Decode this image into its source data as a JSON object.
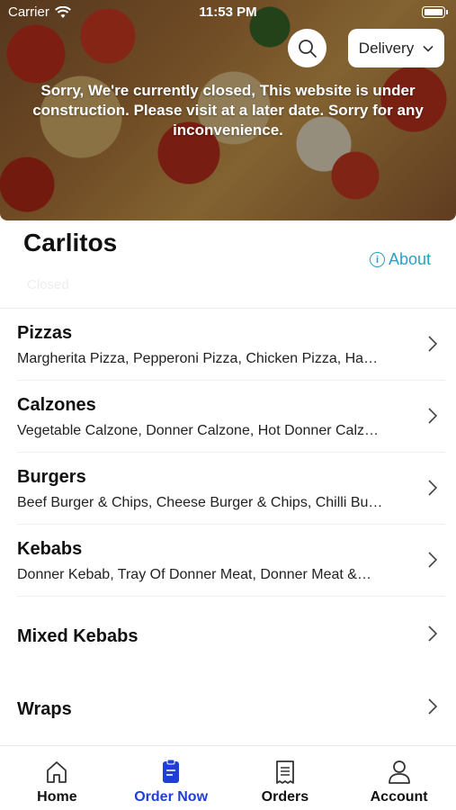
{
  "status_bar": {
    "carrier": "Carrier",
    "time": "11:53 PM"
  },
  "header": {
    "delivery_label": "Delivery",
    "closed_message": "Sorry, We're currently closed, This website is under construction. Please visit at a later date. Sorry for any inconvenience."
  },
  "restaurant": {
    "name": "Carlitos",
    "about_label": "About",
    "status": "Closed"
  },
  "categories": [
    {
      "title": "Pizzas",
      "subtitle": "Margherita Pizza, Pepperoni Pizza, Chicken Pizza, Ha…"
    },
    {
      "title": "Calzones",
      "subtitle": "Vegetable Calzone, Donner Calzone, Hot Donner Calz…"
    },
    {
      "title": "Burgers",
      "subtitle": "Beef Burger & Chips, Cheese Burger & Chips, Chilli Bu…"
    },
    {
      "title": "Kebabs",
      "subtitle": "Donner Kebab, Tray Of Donner Meat, Donner Meat &…"
    },
    {
      "title": "Mixed Kebabs"
    },
    {
      "title": "Wraps"
    }
  ],
  "tabs": [
    {
      "label": "Home",
      "icon": "home-icon",
      "active": false
    },
    {
      "label": "Order Now",
      "icon": "order-icon",
      "active": true
    },
    {
      "label": "Orders",
      "icon": "receipt-icon",
      "active": false
    },
    {
      "label": "Account",
      "icon": "person-icon",
      "active": false
    }
  ],
  "colors": {
    "accent": "#1f3fd8",
    "link": "#2b9fc9"
  }
}
